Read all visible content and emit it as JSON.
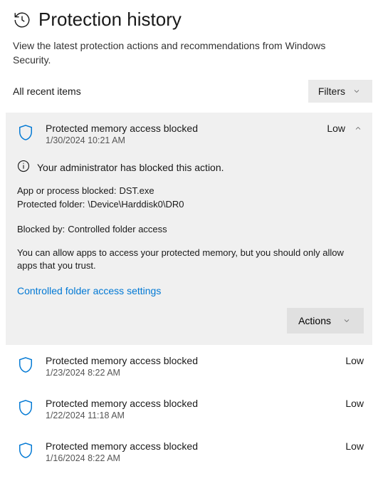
{
  "page": {
    "title": "Protection history",
    "subtitle": "View the latest protection actions and recommendations from Windows Security."
  },
  "section": {
    "label": "All recent items",
    "filters_label": "Filters"
  },
  "expanded": {
    "title": "Protected memory access blocked",
    "time": "1/30/2024 10:21 AM",
    "severity": "Low",
    "admin_msg": "Your administrator has blocked this action.",
    "kv": {
      "app_key": "App or process blocked:",
      "app_val": "DST.exe",
      "folder_key": "Protected folder:",
      "folder_val": "\\Device\\Harddisk0\\DR0",
      "blockedby_key": "Blocked by:",
      "blockedby_val": "Controlled folder access"
    },
    "desc": "You can allow apps to access your protected memory, but you should only allow apps that you trust.",
    "link": "Controlled folder access settings",
    "actions_label": "Actions"
  },
  "items": [
    {
      "title": "Protected memory access blocked",
      "time": "1/23/2024 8:22 AM",
      "severity": "Low"
    },
    {
      "title": "Protected memory access blocked",
      "time": "1/22/2024 11:18 AM",
      "severity": "Low"
    },
    {
      "title": "Protected memory access blocked",
      "time": "1/16/2024 8:22 AM",
      "severity": "Low"
    }
  ]
}
